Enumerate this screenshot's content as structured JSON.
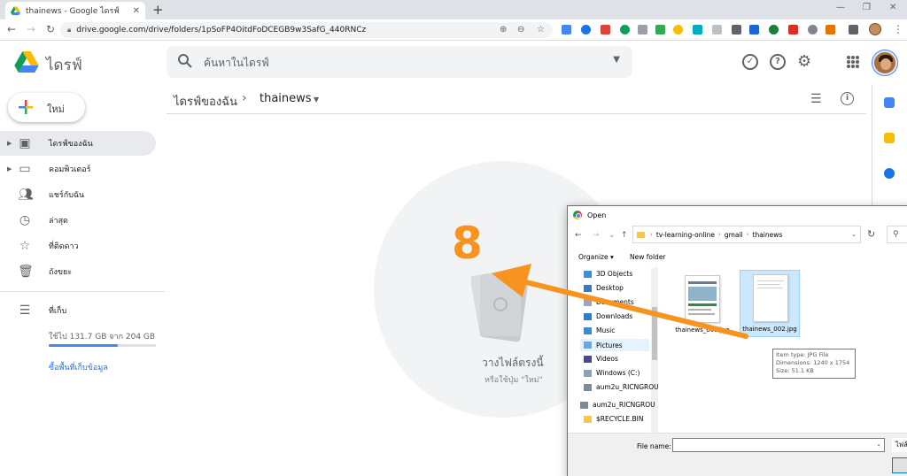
{
  "browser": {
    "tab_title": "thainews - Google ไดรฟ์",
    "url": "drive.google.com/drive/folders/1pSoFP4OitdFoDCEGB9w3SafG_440RNCz"
  },
  "drive": {
    "brand": "ไดรฟ์",
    "search_placeholder": "ค้นหาในไดรฟ์",
    "new_label": "ใหม่",
    "nav": [
      {
        "label": "ไดรฟ์ของฉัน",
        "icon": "my-drive-icon"
      },
      {
        "label": "คอมพิวเตอร์",
        "icon": "computer-icon"
      },
      {
        "label": "แชร์กับฉัน",
        "icon": "shared-icon"
      },
      {
        "label": "ล่าสุด",
        "icon": "clock-icon"
      },
      {
        "label": "ที่ติดดาว",
        "icon": "star-icon"
      },
      {
        "label": "ถังขยะ",
        "icon": "trash-icon"
      }
    ],
    "storage_label": "ที่เก็บ",
    "storage_used": "ใช้ไป 131.7 GB จาก 204 GB",
    "storage_fraction": 0.645,
    "buy_storage": "ซื้อพื้นที่เก็บข้อมูล",
    "breadcrumb_root": "ไดรฟ์ของฉัน",
    "breadcrumb_current": "thainews",
    "drop_title": "วางไฟล์ตรงนี้",
    "drop_subtitle": "หรือใช้ปุ่ม \"ใหม่\"",
    "step_number": "8"
  },
  "dialog": {
    "title": "Open",
    "path": [
      "tv-learning-online",
      "gmail",
      "thainews"
    ],
    "organize": "Organize ▾",
    "new_folder": "New folder",
    "tree": [
      "3D Objects",
      "Desktop",
      "Documents",
      "Downloads",
      "Music",
      "Pictures",
      "Videos",
      "Windows (C:)",
      "aum2u_RICNGROU",
      "aum2u_RICNGROU",
      "$RECYCLE.BIN"
    ],
    "selected_tree_item": "Pictures",
    "files": [
      "thainews_001.jpg",
      "thainews_002.jpg"
    ],
    "tooltip": [
      "Item type: JPG File",
      "Dimensions: 1240 x 1754",
      "Size: 51.1 KB"
    ],
    "filename_label": "File name:",
    "filetype_label": "ไฟล์"
  },
  "colors": {
    "accent": "#f7931e",
    "link": "#1a73e8",
    "drop_bg": "#f1f3f4"
  }
}
